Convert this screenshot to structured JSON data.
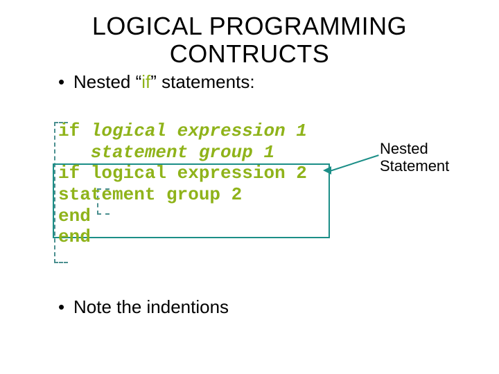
{
  "title_line1": "LOGICAL PROGRAMMING",
  "title_line2": "CONTRUCTS",
  "bullet1_prefix": "Nested “",
  "bullet1_if": "if",
  "bullet1_suffix": "” statements:",
  "bullet2": "Note the indentions",
  "code": {
    "l1a": "if",
    "l1b": " logical expression 1",
    "l2": "   statement group 1",
    "l3a": "if",
    "l3b": " logical expression 2",
    "l4": "statement group 2",
    "l5": "end",
    "l6": "end"
  },
  "note_line1": "Nested",
  "note_line2": "Statement",
  "colors": {
    "accent_green": "#8fb31a",
    "teal": "#1b8e87"
  }
}
